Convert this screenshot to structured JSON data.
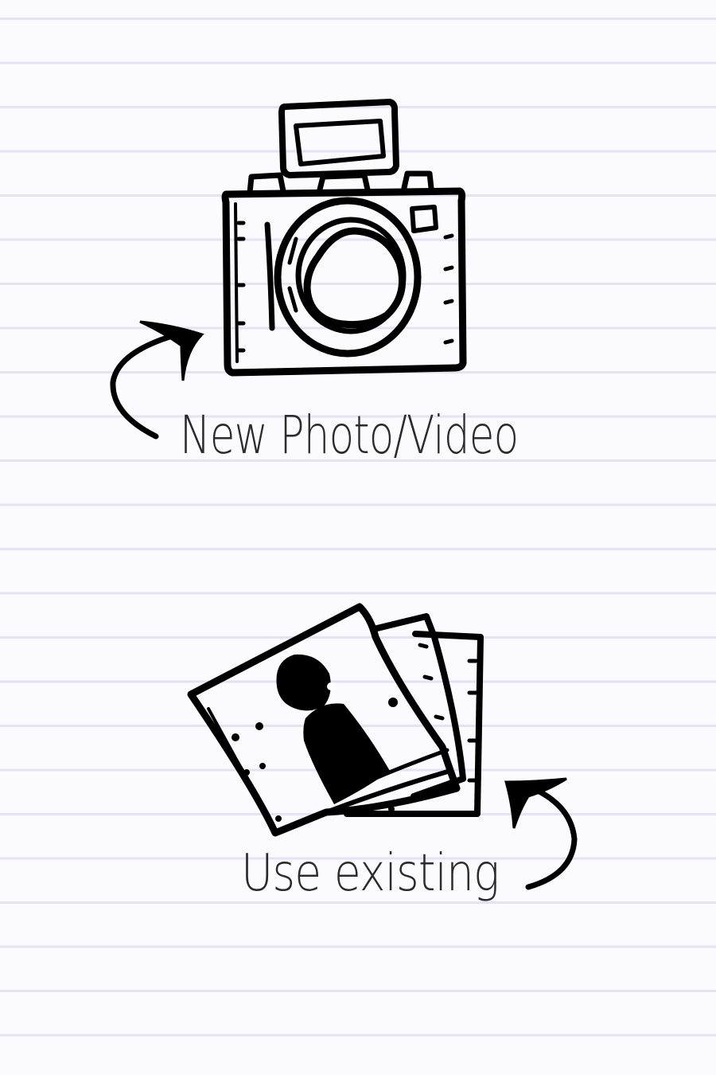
{
  "options": {
    "new_media": {
      "label": "New Photo/Video",
      "icon": "camera-icon"
    },
    "existing_media": {
      "label": "Use existing",
      "icon": "photos-icon"
    }
  },
  "colors": {
    "paper": "#fbfbff",
    "rule_line": "#e6e2f4",
    "ink": "#000000",
    "text": "#2b2b2b"
  }
}
